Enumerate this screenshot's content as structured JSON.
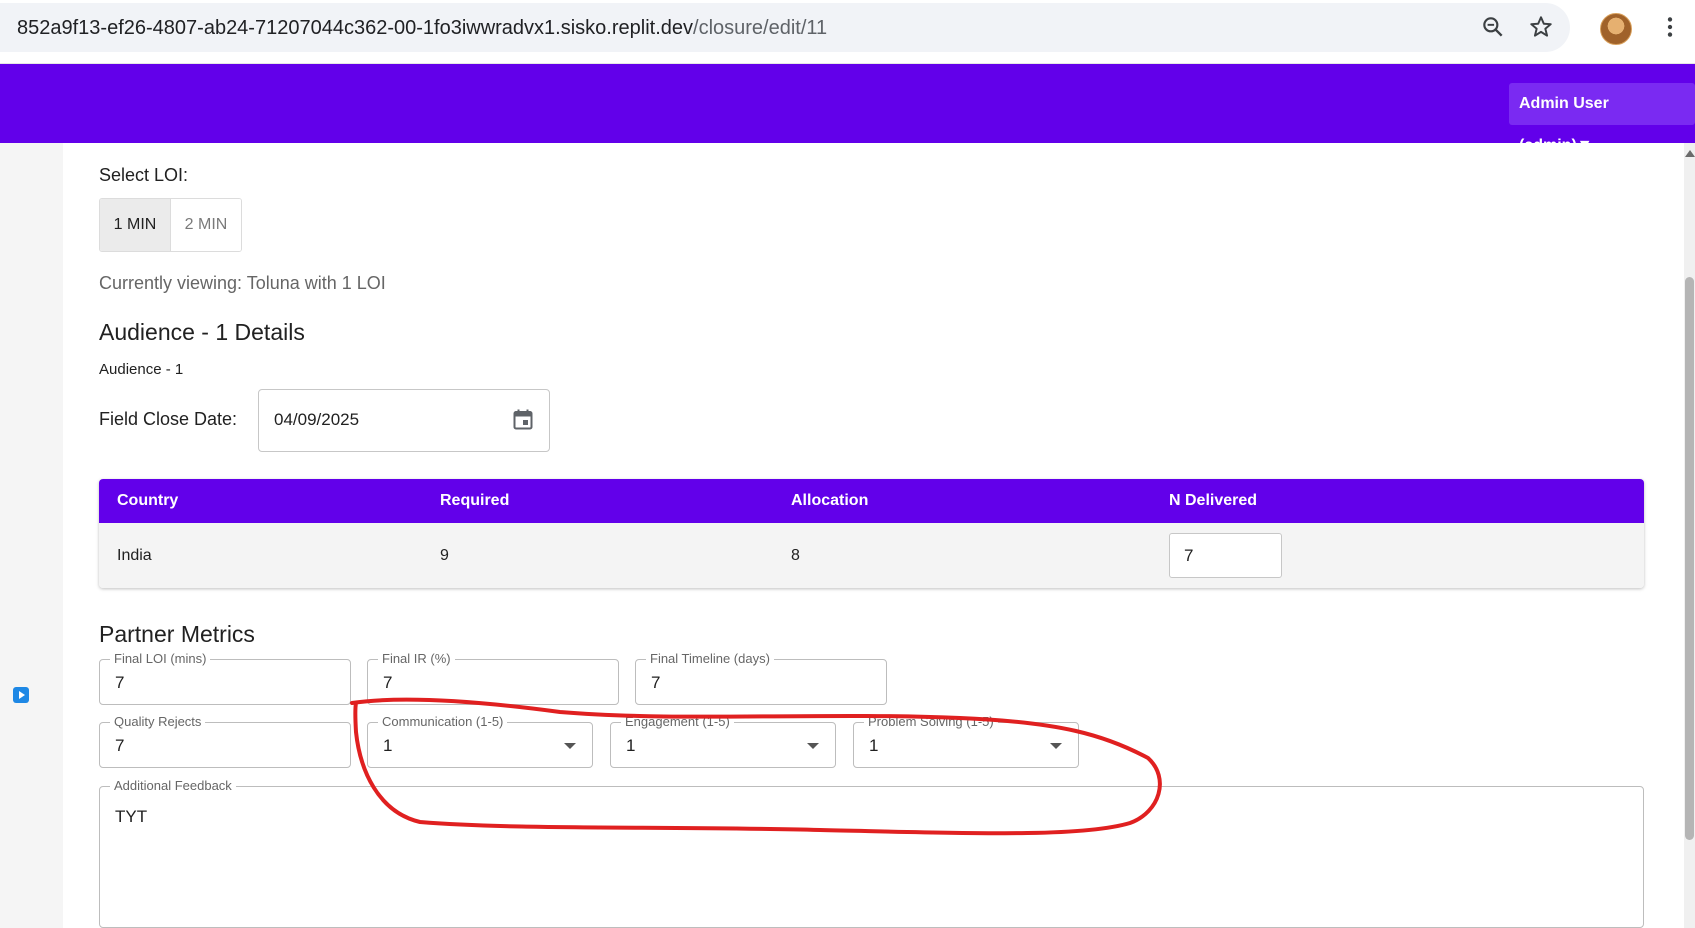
{
  "browser": {
    "url_host": "852a9f13-ef26-4807-ab24-71207044c362-00-1fo3iwwradvx1.sisko.replit.dev",
    "url_path": "/closure/edit/11",
    "icons": [
      "zoom-icon",
      "star-icon",
      "avatar",
      "menu-kebab-icon"
    ]
  },
  "header": {
    "user_menu": "Admin User (admin)▼",
    "background": "#6200ea"
  },
  "loi": {
    "label": "Select LOI:",
    "options": [
      "1 MIN",
      "2 MIN"
    ],
    "selected": "1 MIN",
    "viewing": "Currently viewing: Toluna with 1 LOI"
  },
  "audience": {
    "heading": "Audience - 1 Details",
    "subtitle": "Audience - 1",
    "field_close_label": "Field Close Date:",
    "field_close_value": "04/09/2025"
  },
  "table": {
    "headers": [
      "Country",
      "Required",
      "Allocation",
      "N Delivered"
    ],
    "rows": [
      {
        "country": "India",
        "required": "9",
        "allocation": "8",
        "delivered": "7"
      }
    ]
  },
  "partner_metrics": {
    "heading": "Partner Metrics",
    "final_loi": {
      "label": "Final LOI (mins)",
      "value": "7"
    },
    "final_ir": {
      "label": "Final IR (%)",
      "value": "7"
    },
    "final_timeline": {
      "label": "Final Timeline (days)",
      "value": "7"
    },
    "quality_rejects": {
      "label": "Quality Rejects",
      "value": "7"
    },
    "communication": {
      "label": "Communication (1-5)",
      "value": "1"
    },
    "engagement": {
      "label": "Engagement (1-5)",
      "value": "1"
    },
    "problem_solving": {
      "label": "Problem Solving (1-5)",
      "value": "1"
    },
    "feedback": {
      "label": "Additional Feedback",
      "value": "TYT"
    }
  },
  "annotation_color": "#e02020"
}
